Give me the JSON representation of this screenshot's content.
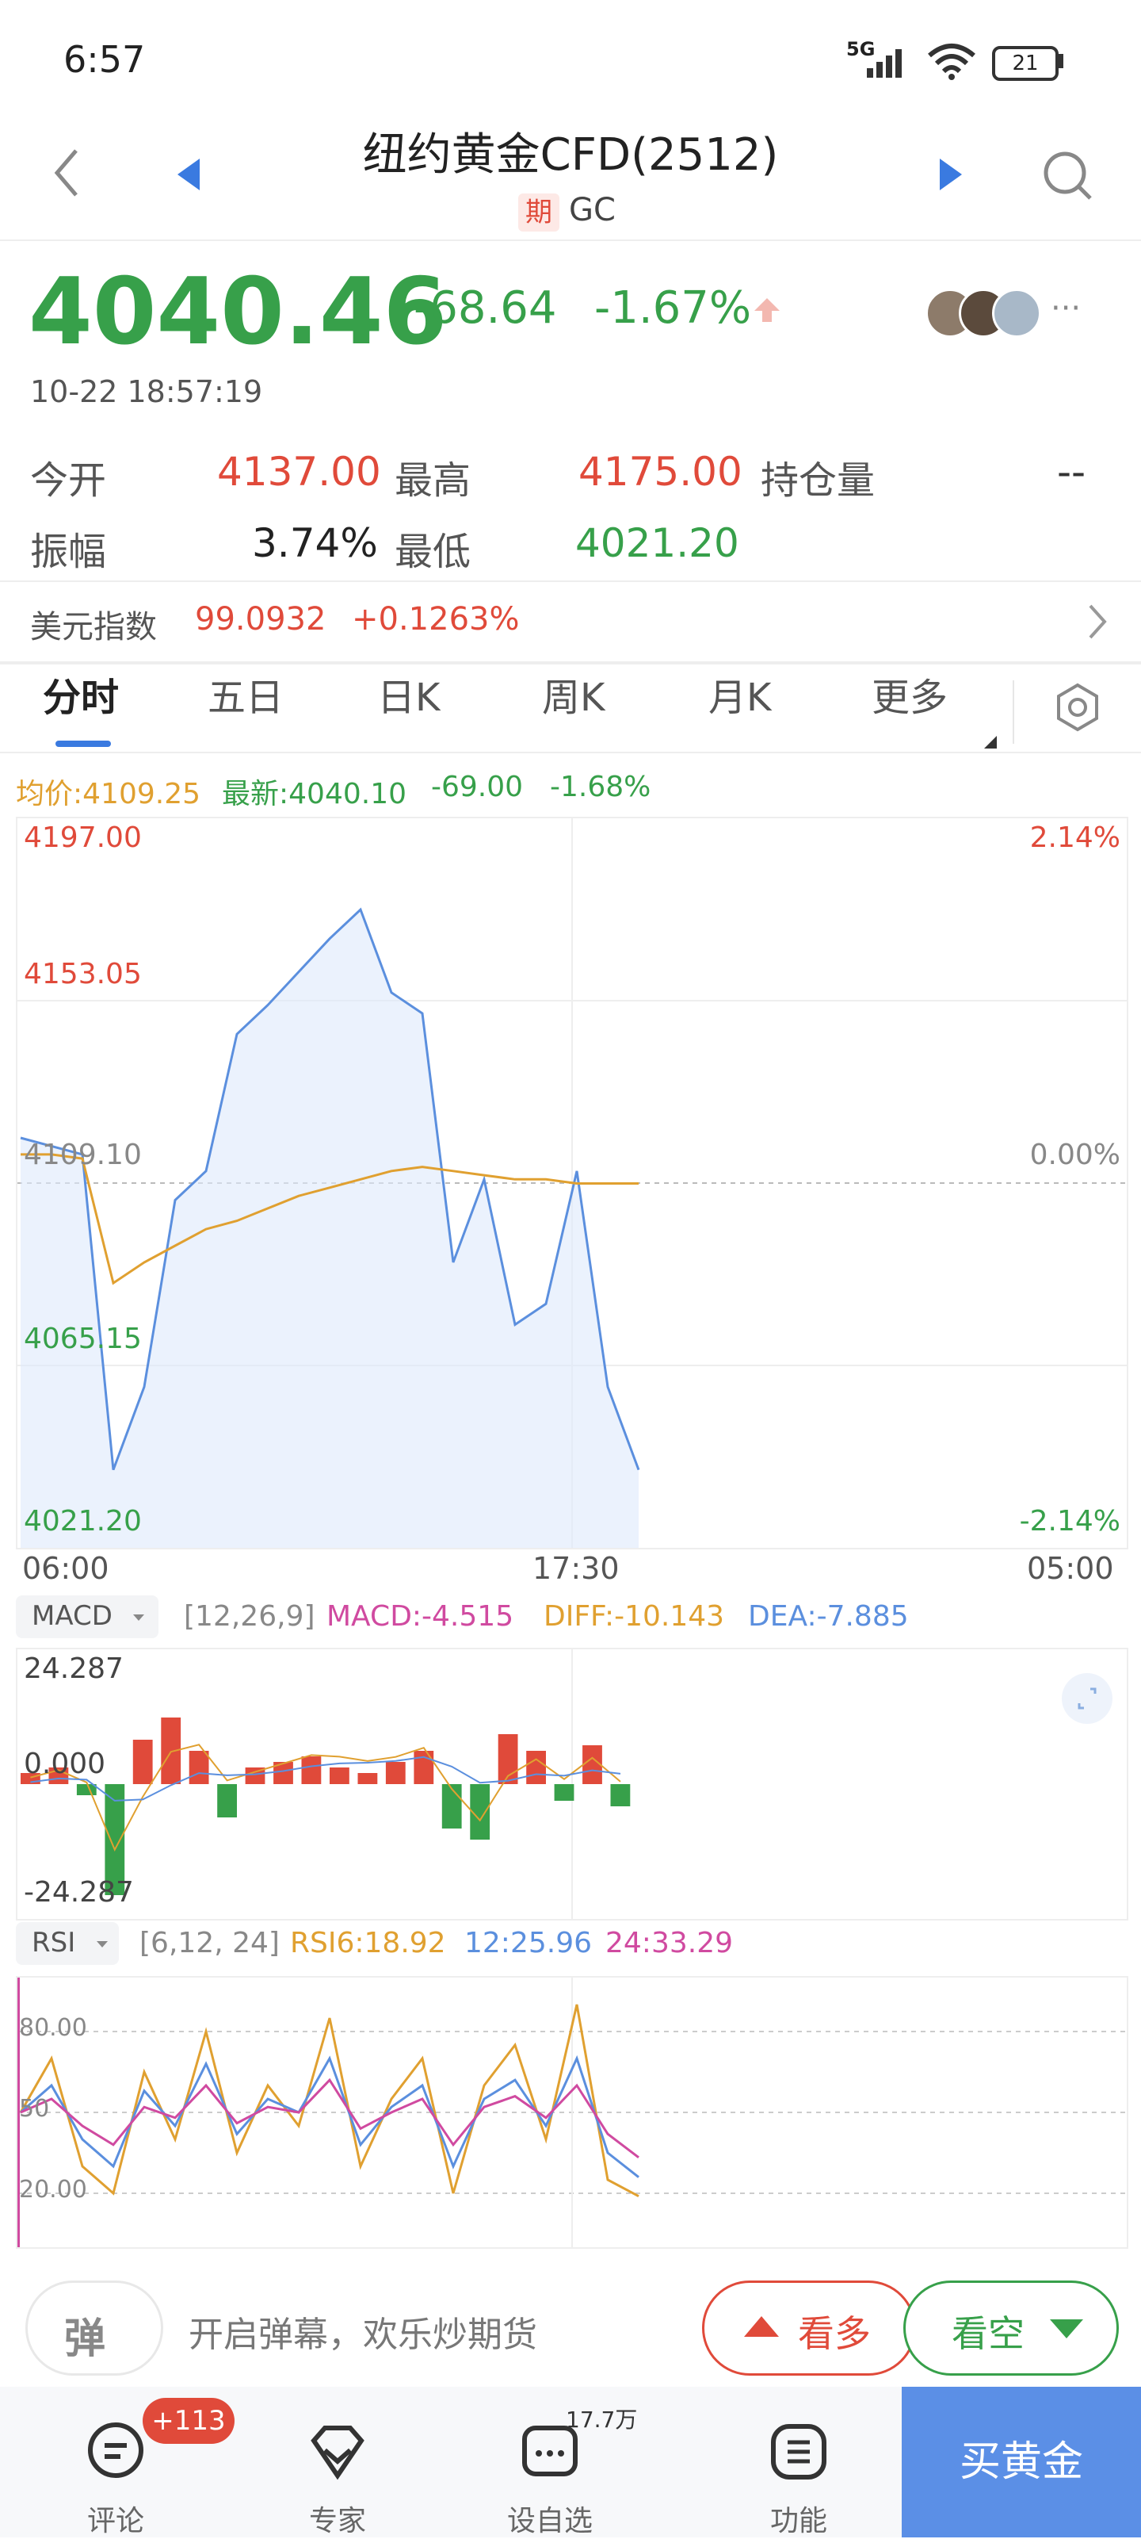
{
  "status": {
    "time": "6:57",
    "network": "5G",
    "battery": "21"
  },
  "header": {
    "title": "纽约黄金CFD(2512)",
    "tag": "期",
    "code": "GC"
  },
  "quote": {
    "price": "4040.46",
    "change": "-68.64",
    "change_pct": "-1.67%",
    "datetime": "10-22 18:57:19",
    "more": "···"
  },
  "stats": {
    "open_label": "今开",
    "open_value": "4137.00",
    "high_label": "最高",
    "high_value": "4175.00",
    "oi_label": "持仓量",
    "oi_value": "--",
    "amp_label": "振幅",
    "amp_value": "3.74%",
    "low_label": "最低",
    "low_value": "4021.20"
  },
  "usd_index": {
    "label": "美元指数",
    "value": "99.0932",
    "change": "+0.1263%"
  },
  "tabs": [
    "分时",
    "五日",
    "日K",
    "周K",
    "月K",
    "更多"
  ],
  "chart_header": {
    "avg": "均价:4109.25",
    "latest": "最新:4040.10",
    "chg": "-69.00",
    "pct": "-1.68%"
  },
  "price_chart": {
    "y_left": [
      "4197.00",
      "4153.05",
      "4109.10",
      "4065.15",
      "4021.20"
    ],
    "y_right": [
      "2.14%",
      "0.00%",
      "-2.14%"
    ],
    "x_ticks": [
      "06:00",
      "17:30",
      "05:00"
    ]
  },
  "macd": {
    "selector": "MACD",
    "params": "[12,26,9]",
    "macd": "MACD:-4.515",
    "diff": "DIFF:-10.143",
    "dea": "DEA:-7.885",
    "y_labels": [
      "24.287",
      "0.000",
      "-24.287"
    ]
  },
  "rsi": {
    "selector": "RSI",
    "params": "[6,12, 24]",
    "rsi6": "RSI6:18.92",
    "rsi12": "12:25.96",
    "rsi24": "24:33.29",
    "y_labels": [
      "80.00",
      "50",
      "20.00"
    ]
  },
  "bottom_bar": {
    "danmu_icon": "弹",
    "danmu_text": "开启弹幕，欢乐炒期货",
    "bull": "看多",
    "bear": "看空"
  },
  "nav": {
    "comments": "评论",
    "comments_badge": "+113",
    "expert": "专家",
    "watchlist": "设自选",
    "watchlist_count": "17.7万",
    "functions": "功能",
    "buy": "买黄金"
  },
  "chart_data": [
    {
      "type": "line",
      "title": "",
      "x": [
        "06:00",
        "17:30",
        "05:00"
      ],
      "ylim": [
        4021.2,
        4197.0
      ],
      "series": [
        {
          "name": "",
          "values": [
            4120,
            4118,
            4116,
            4040,
            4060,
            4105,
            4112,
            4145,
            4152,
            4160,
            4168,
            4175,
            4155,
            4150,
            4090,
            4110,
            4075,
            4080,
            4112,
            4060,
            4040
          ]
        },
        {
          "name": "均价",
          "values": [
            4116,
            4116,
            4115,
            4085,
            4090,
            4094,
            4098,
            4100,
            4103,
            4106,
            4108,
            4110,
            4112,
            4113,
            4112,
            4111,
            4110,
            4110,
            4109,
            4109,
            4109
          ]
        }
      ]
    },
    {
      "type": "bar",
      "title": "MACD",
      "ylim": [
        -24.287,
        24.287
      ],
      "values": [
        2,
        3,
        -2,
        -20,
        8,
        12,
        6,
        -6,
        3,
        4,
        5,
        3,
        2,
        4,
        6,
        -8,
        -10,
        9,
        6,
        -3,
        7,
        -4
      ]
    },
    {
      "type": "line",
      "title": "RSI",
      "ylim": [
        0,
        100
      ],
      "series": [
        {
          "name": "RSI6",
          "values": [
            50,
            70,
            30,
            20,
            65,
            40,
            80,
            35,
            60,
            45,
            85,
            30,
            55,
            70,
            20,
            60,
            75,
            40,
            90,
            25,
            18.92
          ]
        },
        {
          "name": "12",
          "values": [
            50,
            60,
            40,
            30,
            58,
            45,
            68,
            42,
            55,
            50,
            70,
            38,
            52,
            60,
            30,
            55,
            62,
            45,
            70,
            35,
            25.96
          ]
        },
        {
          "name": "24",
          "values": [
            50,
            55,
            45,
            38,
            52,
            48,
            60,
            46,
            52,
            50,
            62,
            44,
            50,
            55,
            38,
            52,
            56,
            48,
            60,
            42,
            33.29
          ]
        }
      ]
    }
  ]
}
